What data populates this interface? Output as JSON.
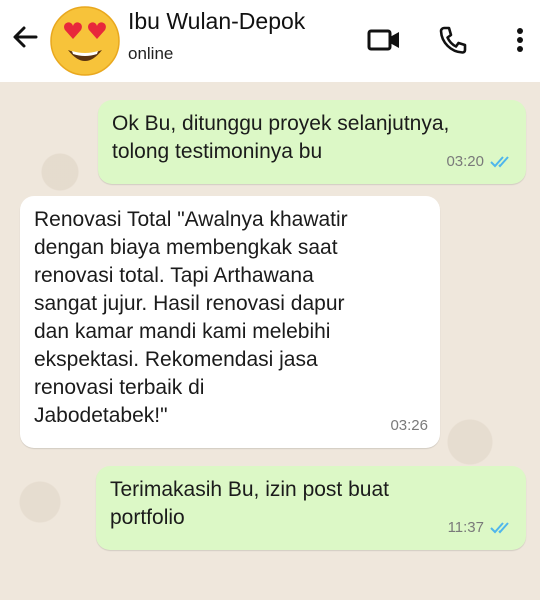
{
  "header": {
    "contact_name": "Ibu Wulan-Depok",
    "status": "online",
    "avatar_icon": "heart-eyes-emoji-icon",
    "icons": [
      "back-arrow-icon",
      "video-call-icon",
      "phone-icon",
      "more-vert-icon"
    ]
  },
  "messages": [
    {
      "direction": "outgoing",
      "text": "Ok Bu, ditunggu proyek selanjutnya,\ntolong testimoninya bu",
      "time": "03:20",
      "read": true
    },
    {
      "direction": "incoming",
      "text": "Renovasi Total \"Awalnya khawatir\ndengan biaya membengkak saat\nrenovasi total. Tapi Arthawana\nsangat jujur. Hasil renovasi dapur\ndan kamar mandi kami melebihi\nekspektasi. Rekomendasi jasa\nrenovasi terbaik di\nJabodetabek!\"",
      "time": "03:26",
      "read": null
    },
    {
      "direction": "outgoing",
      "text": "Terimakasih Bu, izin post buat\nportfolio",
      "time": "11:37",
      "read": true
    }
  ],
  "colors": {
    "outgoing_bubble": "#dcf8c6",
    "incoming_bubble": "#ffffff",
    "read_ticks": "#4fb6ec",
    "wallpaper": "#efe7dc"
  }
}
